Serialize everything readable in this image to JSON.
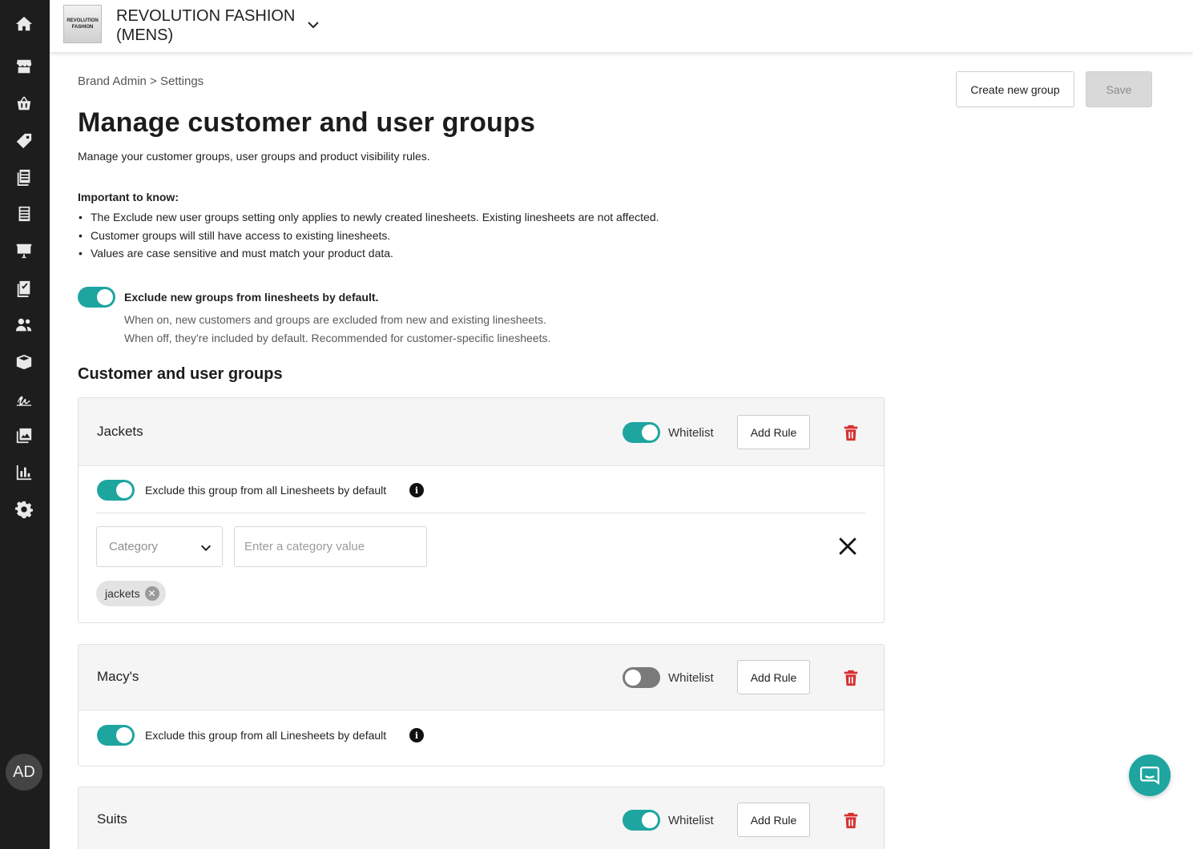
{
  "brand": {
    "logo_text": "REVOLUTION FASHION",
    "name": "REVOLUTION FASHION (MENS)"
  },
  "sidebar": {
    "items": [
      {
        "icon": "home-icon"
      },
      {
        "icon": "store-icon"
      },
      {
        "icon": "basket-icon"
      },
      {
        "icon": "tag-icon"
      },
      {
        "icon": "linesheet-icon"
      },
      {
        "icon": "catalog-icon"
      },
      {
        "icon": "presentation-icon"
      },
      {
        "icon": "checklist-icon"
      },
      {
        "icon": "users-icon"
      },
      {
        "icon": "box-icon"
      },
      {
        "icon": "signature-icon"
      },
      {
        "icon": "images-icon"
      },
      {
        "icon": "chart-icon"
      },
      {
        "icon": "gear-icon"
      }
    ],
    "avatar_initials": "AD"
  },
  "header": {
    "breadcrumb": "Brand Admin > Settings",
    "title": "Manage customer and user groups",
    "subtitle": "Manage your customer groups, user groups and product visibility rules.",
    "create_button": "Create new group",
    "save_button": "Save"
  },
  "notes": {
    "heading": "Important to know:",
    "items": [
      "The Exclude new user groups setting only applies to newly created linesheets. Existing linesheets are not affected.",
      "Customer groups will still have access to existing linesheets.",
      "Values are case sensitive and must match your product data."
    ]
  },
  "global_exclude": {
    "on": true,
    "label": "Exclude new groups from linesheets by default.",
    "help_line1": "When on, new customers and groups are excluded from new and existing linesheets.",
    "help_line2": "When off, they're included by default. Recommended for customer-specific linesheets."
  },
  "groups_section": {
    "title": "Customer and user groups",
    "whitelist_label": "Whitelist",
    "add_rule_label": "Add Rule",
    "exclude_label": "Exclude this group from all Linesheets by default",
    "info_glyph": "i",
    "groups": [
      {
        "name": "Jackets",
        "whitelist_on": true,
        "exclude_on": true,
        "rule": {
          "select_value": "Category",
          "input_placeholder": "Enter a category value",
          "chips": [
            "jackets"
          ]
        }
      },
      {
        "name": "Macy's",
        "whitelist_on": false,
        "exclude_on": true
      },
      {
        "name": "Suits",
        "whitelist_on": true
      }
    ]
  },
  "colors": {
    "accent": "#1ea5a0",
    "sidebar": "#1d1d1d",
    "danger": "#d63031",
    "toggle_off": "#7a7a7a"
  }
}
